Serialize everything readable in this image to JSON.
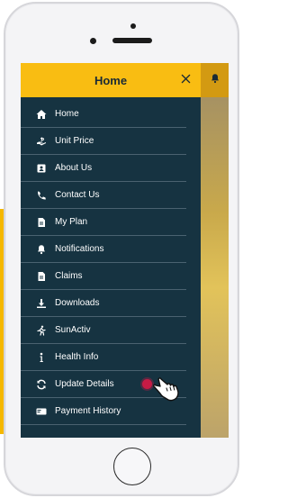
{
  "drawer": {
    "title": "Home",
    "close_icon": "close-icon"
  },
  "app_header": {
    "icon": "bell-icon"
  },
  "menu": {
    "items": [
      {
        "label": "Home",
        "icon": "home-icon"
      },
      {
        "label": "Unit Price",
        "icon": "money-hand-icon"
      },
      {
        "label": "About Us",
        "icon": "id-card-icon"
      },
      {
        "label": "Contact Us",
        "icon": "phone-icon"
      },
      {
        "label": "My Plan",
        "icon": "document-icon"
      },
      {
        "label": "Notifications",
        "icon": "bell-icon"
      },
      {
        "label": "Claims",
        "icon": "document-icon"
      },
      {
        "label": "Downloads",
        "icon": "download-icon"
      },
      {
        "label": "SunActiv",
        "icon": "running-icon"
      },
      {
        "label": "Health Info",
        "icon": "info-icon"
      },
      {
        "label": "Update Details",
        "icon": "refresh-icon"
      },
      {
        "label": "Payment History",
        "icon": "payment-card-icon"
      }
    ]
  },
  "colors": {
    "drawer_bg": "#163341",
    "header_bg": "#f9bd12",
    "highlight_dot": "#c61b45"
  }
}
